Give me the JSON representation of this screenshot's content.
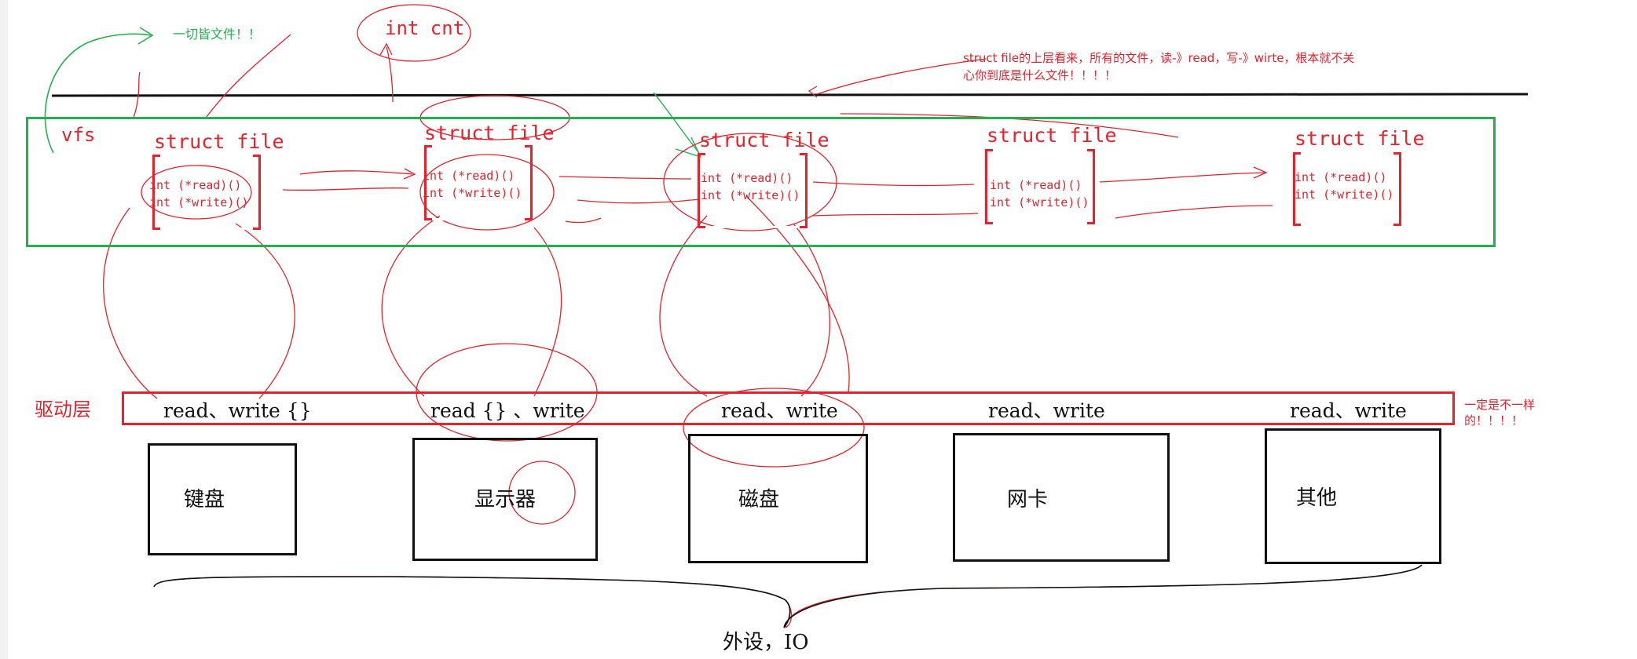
{
  "annotations": {
    "everything_is_file": "一切皆文件！！",
    "int_cnt": "int cnt",
    "vfs": "vfs",
    "upper_note_line1": "struct  file的上层看来，所有的文件，读-》read，写-》wirte，根本就不关",
    "upper_note_line2": "心你到底是什么文件！！！！",
    "driver_layer": "驱动层",
    "driver_note_line1": "一定是不一样",
    "driver_note_line2": "的！！！！",
    "peripherals": "外设，IO"
  },
  "struct_files": [
    {
      "title": "struct file",
      "read": "int (*read)()",
      "write": "int (*write)()"
    },
    {
      "title": "struct file",
      "read": "int (*read)()",
      "write": "int (*write)()"
    },
    {
      "title": "struct file",
      "read": "int (*read)()",
      "write": "int (*write)()"
    },
    {
      "title": "struct file",
      "read": "int (*read)()",
      "write": "int (*write)()"
    },
    {
      "title": "struct file",
      "read": "int (*read)()",
      "write": "int (*write)()"
    }
  ],
  "drivers": [
    "read、write {}",
    "read {} 、write",
    "read、write",
    "read、write",
    "read、write"
  ],
  "devices": [
    "键盘",
    "显示器",
    "磁盘",
    "网卡",
    "其他"
  ],
  "colors": {
    "vfs_border": "#22b14c",
    "driver_border": "#e8212b",
    "annotation": "#e8212b",
    "device_border": "#111111"
  }
}
